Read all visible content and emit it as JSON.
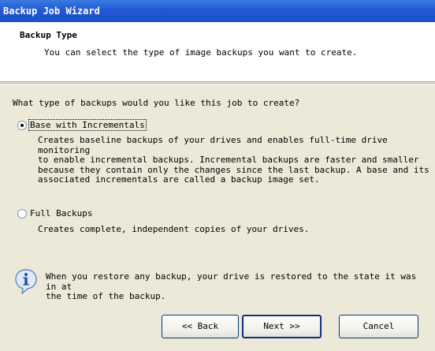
{
  "window": {
    "title": "Backup Job Wizard"
  },
  "header": {
    "title": "Backup Type",
    "subtitle": "You can select the type of image backups you want to create."
  },
  "question": "What type of backups would you like this job to create?",
  "options": [
    {
      "label": "Base with Incrementals",
      "selected": true,
      "description": [
        "Creates baseline backups of your drives and enables full-time drive monitoring",
        "to enable incremental backups. Incremental backups are faster and smaller",
        "because they contain only the changes since the last backup. A base and its",
        "associated incrementals are called a backup image set."
      ]
    },
    {
      "label": "Full Backups",
      "selected": false,
      "description": [
        "Creates complete, independent copies of your drives."
      ]
    }
  ],
  "info": {
    "icon": "info-icon",
    "lines": [
      "When you restore any backup, your drive is restored to the state it was in at",
      "the time of the backup."
    ]
  },
  "buttons": {
    "back": "<< Back",
    "next": "Next >>",
    "cancel": "Cancel"
  }
}
